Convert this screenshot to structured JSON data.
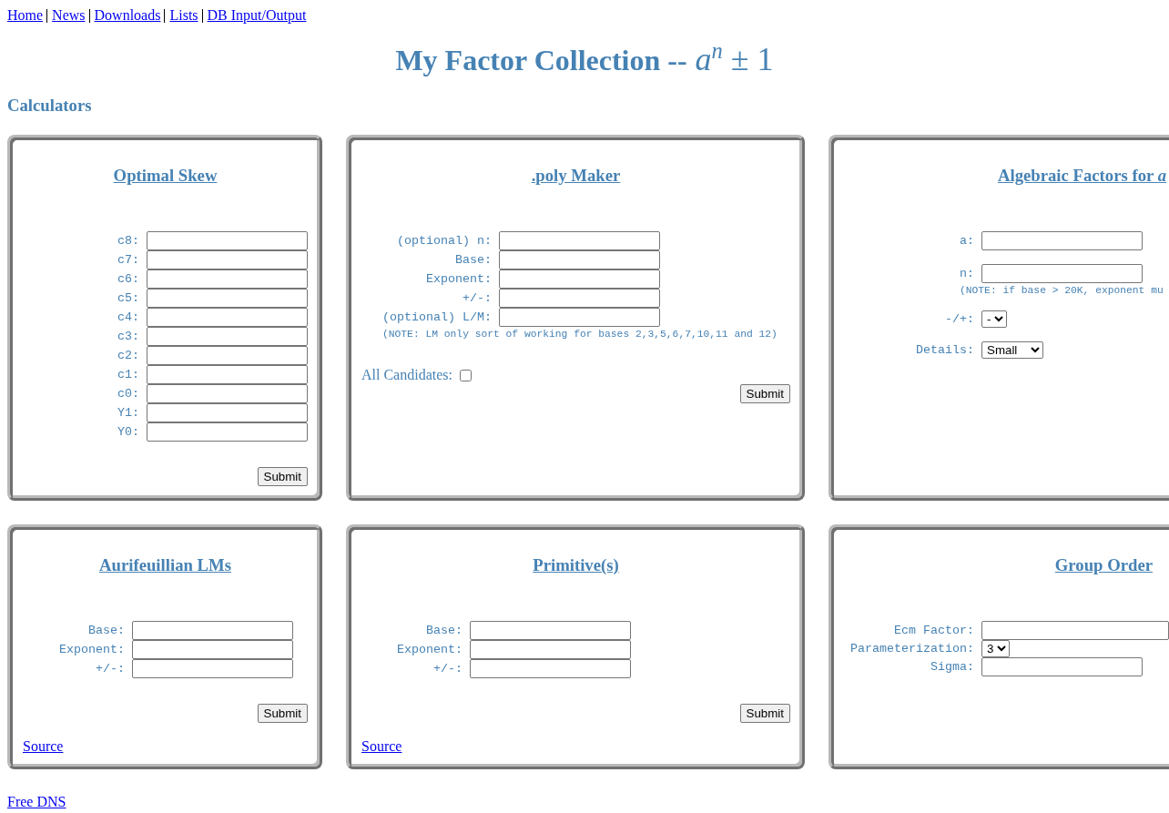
{
  "nav": {
    "links": [
      "Home",
      "News",
      "Downloads",
      "Lists",
      "DB Input/Output"
    ]
  },
  "title": {
    "text": "My Factor Collection --",
    "formula": "*a*$^{n}$ ± 1"
  },
  "section_heading": "Calculators",
  "calculators": [
    {
      "title": "Optimal Skew",
      "fields": [
        {
          "kind": "text",
          "label": "c8:"
        },
        {
          "kind": "text",
          "label": "c7:"
        },
        {
          "kind": "text",
          "label": "c6:"
        },
        {
          "kind": "text",
          "label": "c5:"
        },
        {
          "kind": "text",
          "label": "c4:"
        },
        {
          "kind": "text",
          "label": "c3:"
        },
        {
          "kind": "text",
          "label": "c2:"
        },
        {
          "kind": "text",
          "label": "c1:"
        },
        {
          "kind": "text",
          "label": "c0:"
        },
        {
          "kind": "text",
          "label": "Y1:"
        },
        {
          "kind": "text",
          "label": "Y0:"
        }
      ],
      "submit": "Submit"
    },
    {
      "title": ".poly Maker",
      "fields": [
        {
          "kind": "text",
          "label": "(optional) n:"
        },
        {
          "kind": "text",
          "label": "Base:"
        },
        {
          "kind": "text",
          "label": "Exponent:"
        },
        {
          "kind": "text",
          "label": "+/-:"
        },
        {
          "kind": "text",
          "label": "(optional) L/M:",
          "note": "(NOTE: LM only sort of working for bases 2,3,5,6,7,10,11 and 12)"
        }
      ],
      "option": {
        "label": "All Candidates:",
        "checked": false
      },
      "submit": "Submit"
    },
    {
      "title": "Algebraic Factors for *a*",
      "fields": [
        {
          "kind": "text",
          "label": "a:"
        },
        {
          "kind": "text",
          "label": "n:",
          "note": "(NOTE: if base > 20K, exponent mu"
        },
        {
          "kind": "select",
          "label": "-/+:",
          "value": "-"
        },
        {
          "kind": "select",
          "label": "Details:",
          "value": "Small"
        }
      ]
    },
    {
      "title": "Aurifeuillian LMs",
      "fields": [
        {
          "kind": "text",
          "label": "Base:"
        },
        {
          "kind": "text",
          "label": "Exponent:"
        },
        {
          "kind": "text",
          "label": "+/-:"
        }
      ],
      "submit": "Submit",
      "source_link": "Source"
    },
    {
      "title": "Primitive(s)",
      "fields": [
        {
          "kind": "text",
          "label": "Base:"
        },
        {
          "kind": "text",
          "label": "Exponent:"
        },
        {
          "kind": "text",
          "label": "+/-:"
        }
      ],
      "submit": "Submit",
      "source_link": "Source"
    },
    {
      "title": "Group Order",
      "fields": [
        {
          "kind": "text",
          "label": "Ecm Factor:"
        },
        {
          "kind": "select",
          "label": "Parameterization:",
          "value": "3"
        },
        {
          "kind": "text",
          "label": "Sigma:"
        }
      ]
    }
  ],
  "footer_link": "Free DNS"
}
